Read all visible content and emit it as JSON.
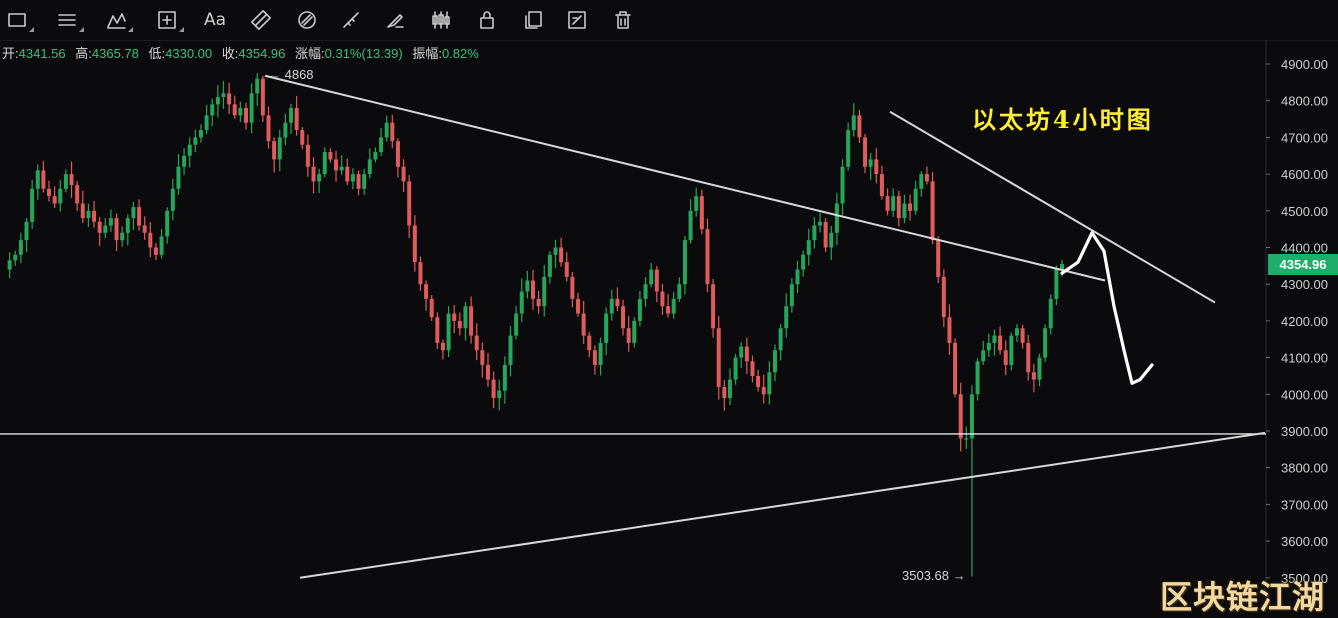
{
  "toolbar": {
    "tools": [
      {
        "name": "rectangle-tool-icon",
        "corner": true
      },
      {
        "name": "parallel-lines-tool-icon",
        "corner": true
      },
      {
        "name": "pattern-tool-icon",
        "corner": true
      },
      {
        "name": "measure-tool-icon",
        "corner": true
      },
      {
        "name": "text-tool-button",
        "label": "Aa"
      },
      {
        "name": "magnet-icon"
      },
      {
        "name": "magnet-strong-icon"
      },
      {
        "name": "ruler-icon"
      },
      {
        "name": "brush-icon"
      },
      {
        "name": "candles-visibility-icon"
      },
      {
        "name": "lock-icon"
      },
      {
        "name": "copy-drawing-icon"
      },
      {
        "name": "drawing-settings-icon"
      },
      {
        "name": "trash-icon"
      }
    ]
  },
  "ohlc": {
    "open_label": "开:",
    "open": "4341.56",
    "high_label": "高:",
    "high": "4365.78",
    "low_label": "低:",
    "low": "4330.00",
    "close_label": "收:",
    "close": "4354.96",
    "change_label": "涨幅:",
    "change": "0.31%(13.39)",
    "amp_label": "振幅:",
    "amp": "0.82%"
  },
  "annotation": {
    "title": "以太坊4小时图",
    "high_marker": "← 4868",
    "low_marker": "3503.68 →",
    "watermark": "区块链江湖",
    "last_price": "4354.96"
  },
  "colors": {
    "up": "#26a65b",
    "down": "#e05c5c",
    "trendline": "#d8d8d8",
    "price_tag": "#1fae6a",
    "title": "#ffee33"
  },
  "chart_data": {
    "type": "candlestick",
    "ylim": [
      3500,
      4950
    ],
    "yticks": [
      "4900.00",
      "4800.00",
      "4700.00",
      "4600.00",
      "4500.00",
      "4400.00",
      "4300.00",
      "4200.00",
      "4100.00",
      "4000.00",
      "3900.00",
      "3800.00",
      "3700.00",
      "3600.00",
      "3500.00"
    ],
    "close_path": [
      4340,
      4365,
      4380,
      4420,
      4470,
      4560,
      4610,
      4560,
      4540,
      4520,
      4560,
      4600,
      4570,
      4520,
      4480,
      4500,
      4470,
      4440,
      4460,
      4480,
      4420,
      4440,
      4480,
      4510,
      4460,
      4440,
      4400,
      4380,
      4430,
      4500,
      4560,
      4620,
      4650,
      4680,
      4700,
      4720,
      4760,
      4790,
      4810,
      4820,
      4790,
      4760,
      4780,
      4740,
      4820,
      4860,
      4760,
      4690,
      4640,
      4700,
      4740,
      4780,
      4720,
      4680,
      4620,
      4580,
      4600,
      4660,
      4640,
      4610,
      4620,
      4580,
      4600,
      4560,
      4600,
      4640,
      4660,
      4700,
      4740,
      4690,
      4620,
      4580,
      4460,
      4360,
      4300,
      4260,
      4210,
      4140,
      4120,
      4220,
      4200,
      4180,
      4240,
      4160,
      4120,
      4080,
      4040,
      3990,
      4010,
      4080,
      4160,
      4220,
      4280,
      4310,
      4260,
      4240,
      4320,
      4380,
      4400,
      4360,
      4320,
      4260,
      4220,
      4160,
      4120,
      4080,
      4140,
      4220,
      4260,
      4240,
      4180,
      4140,
      4200,
      4260,
      4300,
      4340,
      4280,
      4240,
      4220,
      4260,
      4300,
      4420,
      4500,
      4540,
      4450,
      4300,
      4180,
      4020,
      3990,
      4040,
      4100,
      4130,
      4090,
      4050,
      4020,
      4000,
      4060,
      4120,
      4180,
      4240,
      4300,
      4340,
      4380,
      4420,
      4460,
      4470,
      4400,
      4440,
      4520,
      4620,
      4720,
      4760,
      4700,
      4620,
      4640,
      4600,
      4540,
      4500,
      4540,
      4480,
      4520,
      4500,
      4560,
      4600,
      4580,
      4420,
      4320,
      4210,
      4140,
      4000,
      3880,
      3880,
      4000,
      4090,
      4120,
      4140,
      4160,
      4120,
      4080,
      4160,
      4180,
      4140,
      4060,
      4040,
      4100,
      4180,
      4260,
      4340,
      4355
    ],
    "trend_lines": [
      {
        "from": [
          265,
          4868
        ],
        "to": [
          1105,
          4310
        ]
      },
      {
        "from": [
          890,
          4770
        ],
        "to": [
          1215,
          4250
        ]
      },
      {
        "from": [
          300,
          3500
        ],
        "to": [
          1265,
          3895
        ]
      }
    ],
    "horizontal_line": 3892,
    "forecast_path": [
      [
        1062,
        4330
      ],
      [
        1078,
        4360
      ],
      [
        1092,
        4440
      ],
      [
        1104,
        4390
      ],
      [
        1114,
        4240
      ],
      [
        1124,
        4120
      ],
      [
        1132,
        4030
      ],
      [
        1140,
        4040
      ],
      [
        1152,
        4080
      ]
    ],
    "high_point": {
      "x": 265,
      "price": 4868
    },
    "low_point": {
      "x": 975,
      "price": 3503.68
    }
  }
}
